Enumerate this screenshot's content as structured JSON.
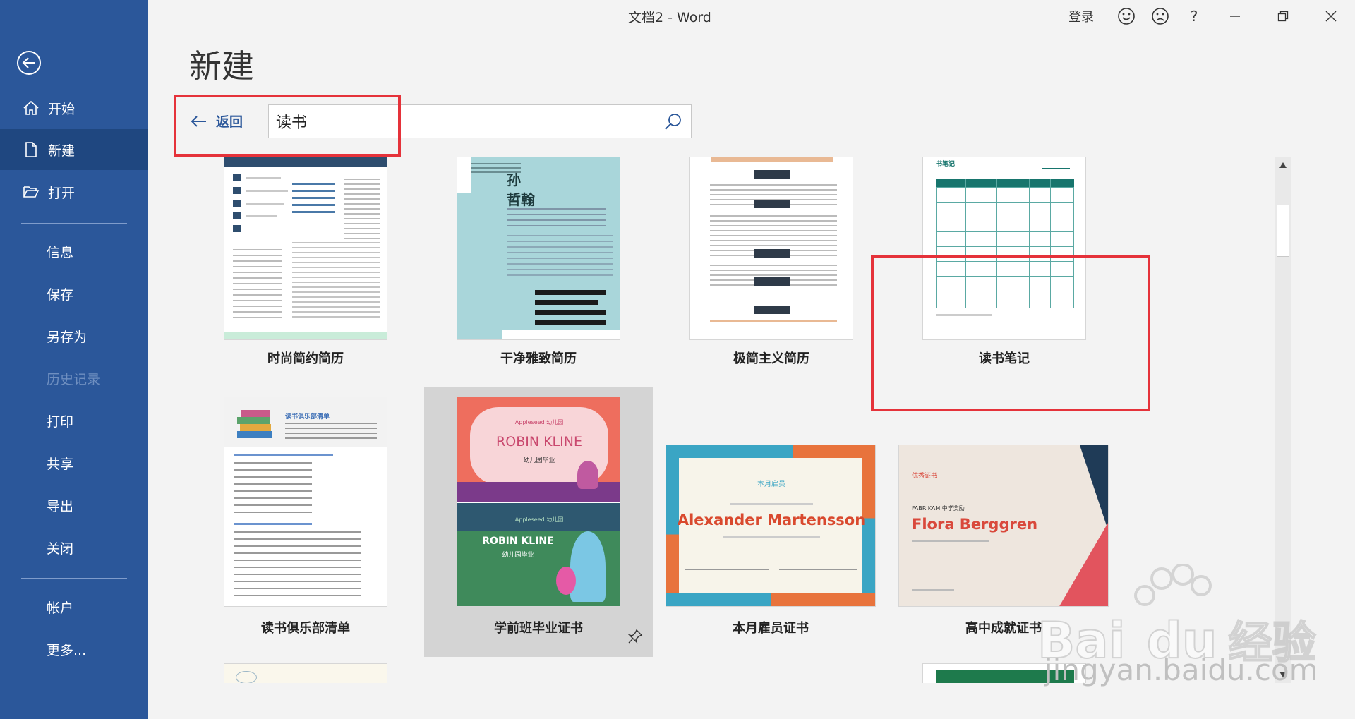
{
  "window": {
    "title": "文档2  -  Word",
    "login": "登录",
    "help": "?"
  },
  "sidebar": {
    "items": [
      {
        "label": "开始",
        "icon": "home-icon"
      },
      {
        "label": "新建",
        "icon": "new-document-icon",
        "active": true
      },
      {
        "label": "打开",
        "icon": "folder-open-icon"
      },
      {
        "label": "信息"
      },
      {
        "label": "保存"
      },
      {
        "label": "另存为"
      },
      {
        "label": "历史记录",
        "disabled": true
      },
      {
        "label": "打印"
      },
      {
        "label": "共享"
      },
      {
        "label": "导出"
      },
      {
        "label": "关闭"
      },
      {
        "label": "帐户"
      },
      {
        "label": "更多..."
      }
    ]
  },
  "main": {
    "title": "新建",
    "back_label": "返回",
    "search_value": "读书",
    "templates": [
      {
        "label": "时尚简约简历"
      },
      {
        "label": "干净雅致简历",
        "name_line1": "孙",
        "name_line2": "哲翰"
      },
      {
        "label": "极简主义简历"
      },
      {
        "label": "读书笔记",
        "header": "书笔记"
      },
      {
        "label": "读书俱乐部清单",
        "header": "读书俱乐部清单"
      },
      {
        "label": "学前班毕业证书",
        "school": "Appleseed 幼儿园",
        "name": "ROBIN KLINE",
        "sub": "幼儿园毕业"
      },
      {
        "label": "本月雇员证书",
        "heading": "本月雇员",
        "name": "Alexander Martensson"
      },
      {
        "label": "高中成就证书",
        "heading": "优秀证书",
        "school": "FABRIKAM 中学奖励",
        "name": "Flora Berggren"
      }
    ]
  },
  "watermark": {
    "brand": "Bai",
    "brand2": "du",
    "cn": "经验",
    "url": "jingyan.baidu.com"
  },
  "colors": {
    "sidebar": "#2b579a",
    "sidebar_active": "#1f4780",
    "highlight": "#e5323a",
    "accent": "#2b579a"
  }
}
